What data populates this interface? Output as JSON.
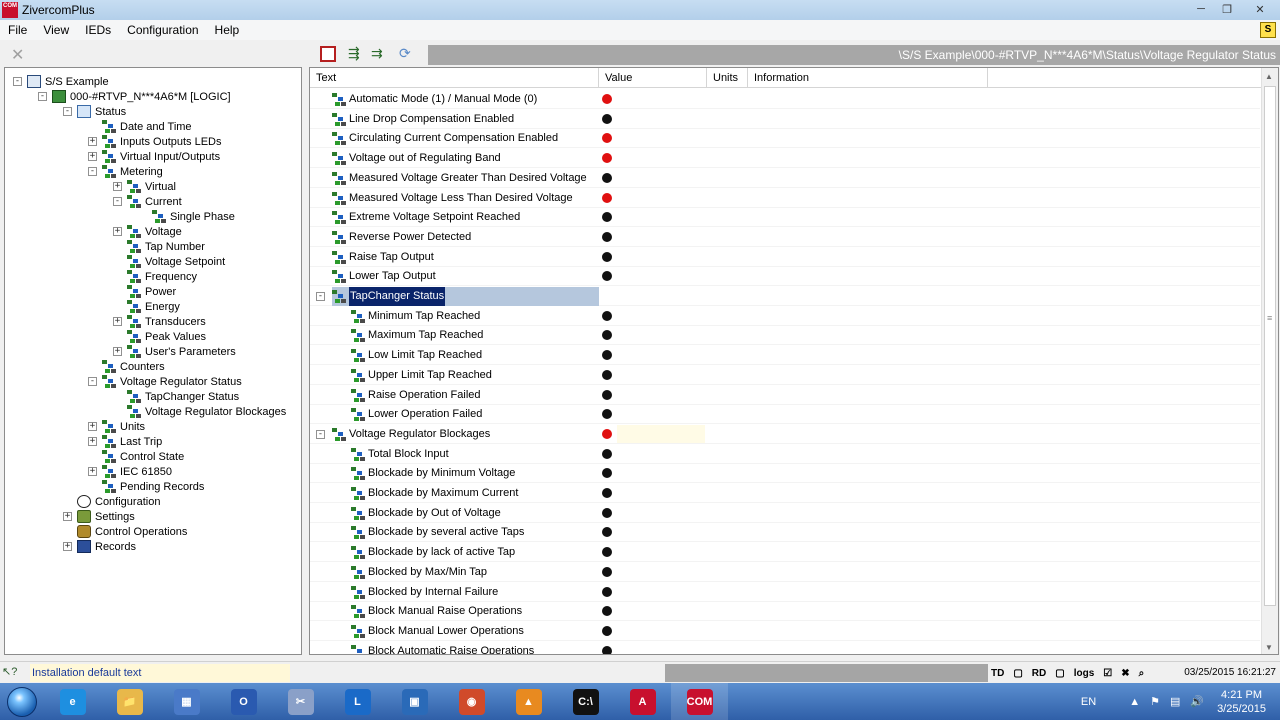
{
  "window": {
    "title": "ZivercomPlus",
    "app_icon_text": "COM"
  },
  "menu": {
    "items": [
      "File",
      "View",
      "IEDs",
      "Configuration",
      "Help"
    ]
  },
  "path": "\\S/S Example\\000-#RTVP_N***4A6*M\\Status\\Voltage Regulator Status",
  "grid": {
    "columns": [
      "Text",
      "Value",
      "Units",
      "Information"
    ],
    "rows": [
      {
        "text": "Automatic Mode (1) / Manual Mode (0)",
        "level": 1,
        "status": "red"
      },
      {
        "text": "Line Drop Compensation Enabled",
        "level": 1,
        "status": "black"
      },
      {
        "text": "Circulating Current Compensation Enabled",
        "level": 1,
        "status": "red"
      },
      {
        "text": "Voltage out of Regulating Band",
        "level": 1,
        "status": "red"
      },
      {
        "text": "Measured Voltage Greater Than Desired Voltage",
        "level": 1,
        "status": "black"
      },
      {
        "text": "Measured Voltage Less Than Desired Voltage",
        "level": 1,
        "status": "red"
      },
      {
        "text": "Extreme Voltage Setpoint Reached",
        "level": 1,
        "status": "black"
      },
      {
        "text": "Reverse Power Detected",
        "level": 1,
        "status": "black"
      },
      {
        "text": "Raise Tap Output",
        "level": 1,
        "status": "black"
      },
      {
        "text": "Lower Tap Output",
        "level": 1,
        "status": "black"
      },
      {
        "text": "TapChanger Status",
        "level": 0,
        "status": "",
        "group": true,
        "selected": true
      },
      {
        "text": "Minimum Tap Reached",
        "level": 2,
        "status": "black"
      },
      {
        "text": "Maximum Tap Reached",
        "level": 2,
        "status": "black"
      },
      {
        "text": "Low Limit Tap Reached",
        "level": 2,
        "status": "black"
      },
      {
        "text": "Upper Limit Tap Reached",
        "level": 2,
        "status": "black"
      },
      {
        "text": "Raise Operation Failed",
        "level": 2,
        "status": "black"
      },
      {
        "text": "Lower Operation Failed",
        "level": 2,
        "status": "black"
      },
      {
        "text": "Voltage Regulator Blockages",
        "level": 0,
        "status": "red",
        "group": true,
        "highlight_value": true
      },
      {
        "text": "Total Block Input",
        "level": 2,
        "status": "black"
      },
      {
        "text": "Blockade by Minimum Voltage",
        "level": 2,
        "status": "black"
      },
      {
        "text": "Blockade by Maximum Current",
        "level": 2,
        "status": "black"
      },
      {
        "text": "Blockade by Out of Voltage",
        "level": 2,
        "status": "black"
      },
      {
        "text": "Blockade by several active Taps",
        "level": 2,
        "status": "black"
      },
      {
        "text": "Blockade by lack of active Tap",
        "level": 2,
        "status": "black"
      },
      {
        "text": "Blocked by Max/Min Tap",
        "level": 2,
        "status": "black"
      },
      {
        "text": "Blocked by Internal Failure",
        "level": 2,
        "status": "black"
      },
      {
        "text": "Block Manual Raise Operations",
        "level": 2,
        "status": "black"
      },
      {
        "text": "Block Manual Lower Operations",
        "level": 2,
        "status": "black"
      },
      {
        "text": "Block Automatic Raise Operations",
        "level": 2,
        "status": "black"
      }
    ]
  },
  "tree": [
    {
      "label": "S/S Example",
      "depth": 0,
      "exp": "-",
      "icon": "station"
    },
    {
      "label": "000-#RTVP_N***4A6*M [LOGIC]",
      "depth": 1,
      "exp": "-",
      "icon": "device"
    },
    {
      "label": "Status",
      "depth": 2,
      "exp": "-",
      "icon": "status"
    },
    {
      "label": "Date and Time",
      "depth": 3,
      "exp": "",
      "icon": "block"
    },
    {
      "label": "Inputs Outputs LEDs",
      "depth": 3,
      "exp": "+",
      "icon": "block"
    },
    {
      "label": "Virtual Input/Outputs",
      "depth": 3,
      "exp": "+",
      "icon": "block"
    },
    {
      "label": "Metering",
      "depth": 3,
      "exp": "-",
      "icon": "block"
    },
    {
      "label": "Virtual",
      "depth": 4,
      "exp": "+",
      "icon": "block"
    },
    {
      "label": "Current",
      "depth": 4,
      "exp": "-",
      "icon": "block"
    },
    {
      "label": "Single Phase",
      "depth": 5,
      "exp": "",
      "icon": "block"
    },
    {
      "label": "Voltage",
      "depth": 4,
      "exp": "+",
      "icon": "block"
    },
    {
      "label": "Tap Number",
      "depth": 4,
      "exp": "",
      "icon": "block"
    },
    {
      "label": "Voltage Setpoint",
      "depth": 4,
      "exp": "",
      "icon": "block"
    },
    {
      "label": "Frequency",
      "depth": 4,
      "exp": "",
      "icon": "block"
    },
    {
      "label": "Power",
      "depth": 4,
      "exp": "",
      "icon": "block"
    },
    {
      "label": "Energy",
      "depth": 4,
      "exp": "",
      "icon": "block"
    },
    {
      "label": "Transducers",
      "depth": 4,
      "exp": "+",
      "icon": "block"
    },
    {
      "label": "Peak Values",
      "depth": 4,
      "exp": "",
      "icon": "block"
    },
    {
      "label": "User's Parameters",
      "depth": 4,
      "exp": "+",
      "icon": "block"
    },
    {
      "label": "Counters",
      "depth": 3,
      "exp": "",
      "icon": "block"
    },
    {
      "label": "Voltage Regulator Status",
      "depth": 3,
      "exp": "-",
      "icon": "block"
    },
    {
      "label": "TapChanger Status",
      "depth": 4,
      "exp": "",
      "icon": "block"
    },
    {
      "label": "Voltage Regulator Blockages",
      "depth": 4,
      "exp": "",
      "icon": "block"
    },
    {
      "label": "Units",
      "depth": 3,
      "exp": "+",
      "icon": "block"
    },
    {
      "label": "Last Trip",
      "depth": 3,
      "exp": "+",
      "icon": "block"
    },
    {
      "label": "Control State",
      "depth": 3,
      "exp": "",
      "icon": "block"
    },
    {
      "label": "IEC 61850",
      "depth": 3,
      "exp": "+",
      "icon": "block"
    },
    {
      "label": "Pending Records",
      "depth": 3,
      "exp": "",
      "icon": "block"
    },
    {
      "label": "Configuration",
      "depth": 2,
      "exp": "",
      "icon": "config"
    },
    {
      "label": "Settings",
      "depth": 2,
      "exp": "+",
      "icon": "settings"
    },
    {
      "label": "Control Operations",
      "depth": 2,
      "exp": "",
      "icon": "control"
    },
    {
      "label": "Records",
      "depth": 2,
      "exp": "+",
      "icon": "records"
    }
  ],
  "status": {
    "message": "Installation default text",
    "icons": [
      "TD",
      "RD",
      "logs"
    ],
    "datetime": "03/25/2015 16:21:27"
  },
  "taskbar": {
    "apps": [
      {
        "name": "internet-explorer",
        "glyph": "e",
        "color": "#1e8fe0"
      },
      {
        "name": "file-explorer",
        "glyph": "📁",
        "color": "#e8b84a"
      },
      {
        "name": "control-panel",
        "glyph": "▦",
        "color": "#4a7ac8"
      },
      {
        "name": "outlook",
        "glyph": "O",
        "color": "#2a5ab0"
      },
      {
        "name": "snipping-tool",
        "glyph": "✂",
        "color": "#8aa0c8"
      },
      {
        "name": "lync",
        "glyph": "L",
        "color": "#1a6ac8"
      },
      {
        "name": "network-app",
        "glyph": "▣",
        "color": "#2a6ab8"
      },
      {
        "name": "chrome",
        "glyph": "◉",
        "color": "#d04a2a"
      },
      {
        "name": "vlc",
        "glyph": "▲",
        "color": "#e88a20"
      },
      {
        "name": "command-prompt",
        "glyph": "C:\\",
        "color": "#111"
      },
      {
        "name": "acrobat",
        "glyph": "A",
        "color": "#c8102e"
      },
      {
        "name": "zivercom",
        "glyph": "COM",
        "color": "#c8102e"
      }
    ],
    "language": "EN",
    "time": "4:21 PM",
    "date": "3/25/2015"
  },
  "colors": {
    "status_red": "#e01010",
    "status_black": "#111111",
    "selection": "#0a246a"
  }
}
